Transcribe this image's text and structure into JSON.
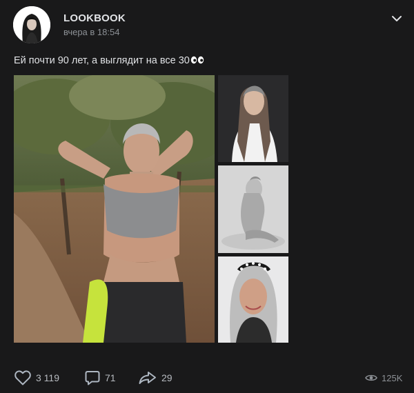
{
  "post": {
    "author": "LOOKBOOK",
    "time": "вчера в 18:54",
    "text": "Ей почти 90 лет, а выглядит на все 30"
  },
  "icons": {
    "avatar": "author-avatar",
    "menu": "chevron-down-icon",
    "like": "heart-icon",
    "comment": "comment-icon",
    "share": "share-arrow-icon",
    "views": "eye-icon",
    "emoji": "eyes-emoji"
  },
  "stats": {
    "likes": "3 119",
    "comments": "71",
    "shares": "29",
    "views": "125K"
  },
  "colors": {
    "background": "#19191a",
    "text": "#e1e3e6",
    "muted": "#8d9196"
  }
}
